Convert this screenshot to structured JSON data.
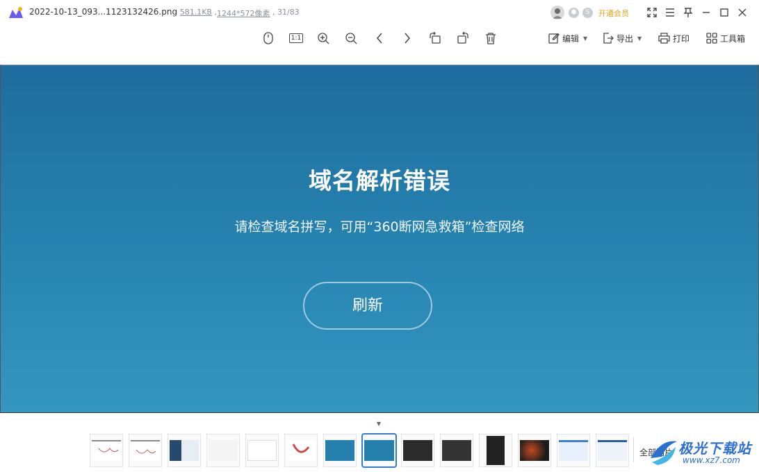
{
  "titlebar": {
    "filename": "2022-10-13_093...1123132426.png",
    "filesize": "581.1KB",
    "resolution": "1244*572像素",
    "position": "31/83",
    "vip_label": "开通会员",
    "icons": [
      "avatar",
      "hexagon-badge-icon",
      "s-badge-icon",
      "fullscreen-icon",
      "menu-icon",
      "pin-icon",
      "minimize-icon",
      "maximize-icon",
      "close-icon"
    ]
  },
  "toolbar": {
    "tools": [
      "mouse-icon",
      "actual-size-icon",
      "zoom-in-icon",
      "zoom-out-icon",
      "previous-icon",
      "next-icon",
      "rotate-left-icon",
      "rotate-right-icon",
      "delete-icon"
    ],
    "actual_size_label": "1:1",
    "edit_label": "编辑",
    "export_label": "导出",
    "print_label": "打印",
    "toolbox_label": "工具箱"
  },
  "content": {
    "title": "域名解析错误",
    "subtitle": "请检查域名拼写，可用“360断网急救箱”检查网络",
    "button_label": "刷新"
  },
  "filmstrip": {
    "thumbnail_count": 14,
    "active_index": 7,
    "all_pictures_label": "全部图片"
  },
  "watermark": {
    "title": "极光下载站",
    "url": "www.xz7.com"
  },
  "colors": {
    "accent": "#2f7bd8",
    "vip": "#e7a21b",
    "content_top": "#1f6c9d",
    "content_bottom": "#3497c0"
  }
}
